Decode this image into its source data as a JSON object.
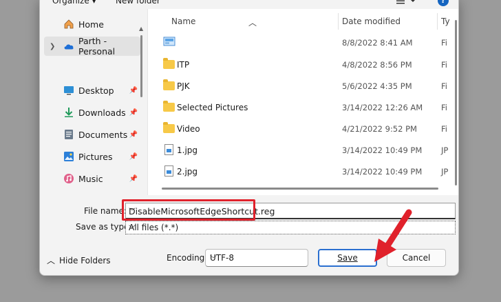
{
  "toolbar": {
    "organize_label": "Organize ▾",
    "new_folder_label": "New folder",
    "help_label": "?"
  },
  "nav": {
    "items": [
      {
        "label": "Home",
        "icon": "home-icon"
      },
      {
        "label": "Parth - Personal",
        "icon": "onedrive-cloud-icon"
      },
      {
        "label": "Desktop",
        "icon": "desktop-icon"
      },
      {
        "label": "Downloads",
        "icon": "download-icon"
      },
      {
        "label": "Documents",
        "icon": "documents-icon"
      },
      {
        "label": "Pictures",
        "icon": "pictures-icon"
      },
      {
        "label": "Music",
        "icon": "music-icon"
      }
    ]
  },
  "filelist": {
    "columns": {
      "name": "Name",
      "date": "Date modified",
      "type": "Ty"
    },
    "rows": [
      {
        "name": "",
        "date": "8/8/2022 8:41 AM",
        "type": "Fi",
        "icon": "image-icon"
      },
      {
        "name": "ITP",
        "date": "4/8/2022 8:56 PM",
        "type": "Fi",
        "icon": "folder-icon"
      },
      {
        "name": "PJK",
        "date": "5/6/2022 4:35 PM",
        "type": "Fi",
        "icon": "folder-icon"
      },
      {
        "name": "Selected Pictures",
        "date": "3/14/2022 12:26 AM",
        "type": "Fi",
        "icon": "folder-icon"
      },
      {
        "name": "Video",
        "date": "4/21/2022 9:52 PM",
        "type": "Fi",
        "icon": "folder-icon"
      },
      {
        "name": "1.jpg",
        "date": "3/14/2022 10:49 PM",
        "type": "JP",
        "icon": "jpg-file-icon"
      },
      {
        "name": "2.jpg",
        "date": "3/14/2022 10:49 PM",
        "type": "JP",
        "icon": "jpg-file-icon"
      }
    ]
  },
  "form": {
    "file_name_label": "File name:",
    "file_name_value": "DisableMicrosoftEdgeShortcut.reg",
    "save_as_type_label": "Save as type:",
    "save_as_type_value": "All files  (*.*)",
    "encoding_label": "Encoding:",
    "encoding_value": "UTF-8"
  },
  "footer": {
    "hide_folders_label": "Hide Folders",
    "save_label": "Save",
    "cancel_label": "Cancel"
  },
  "colors": {
    "highlight": "#e0212b",
    "accent": "#2a6fd0"
  }
}
